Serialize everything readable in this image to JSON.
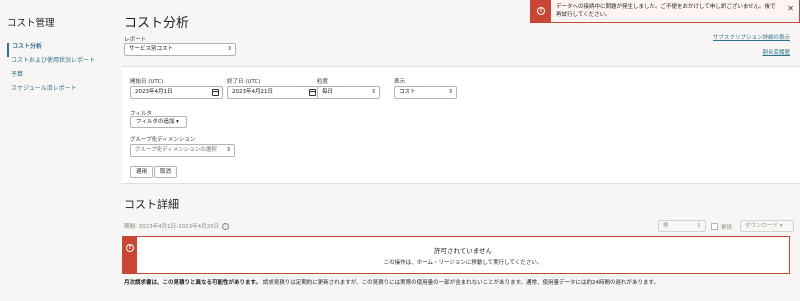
{
  "sidebar": {
    "title": "コスト管理",
    "items": [
      {
        "label": "コスト分析",
        "active": true
      },
      {
        "label": "コストおよび使用状況レポート",
        "active": false
      },
      {
        "label": "予算",
        "active": false
      },
      {
        "label": "スケジュール済レポート",
        "active": false
      }
    ]
  },
  "page": {
    "title": "コスト分析",
    "report_label": "レポート",
    "report_value": "サービス別コスト",
    "links": {
      "subscription": "サブスクリプション詳細の表示",
      "usage_history": "割合変履歴"
    }
  },
  "filters": {
    "start_date_label": "開始日 (UTC)",
    "start_date": "2023年4月1日",
    "end_date_label": "終了日 (UTC)",
    "end_date": "2023年4月21日",
    "granularity_label": "粒度",
    "granularity_value": "毎日",
    "show_label": "表示",
    "show_value": "コスト",
    "filter_label": "フィルタ",
    "add_filter": "フィルタの追加",
    "group_label": "グループ化ディメンション",
    "group_placeholder": "グループ化ディメンションの選択",
    "apply": "適用",
    "cancel": "取消"
  },
  "details": {
    "title": "コスト詳細",
    "period": "期間: 2023年4月1日-2023年4月25日",
    "granularity_select": "棒",
    "checkbox_label": "累積",
    "download": "ダウンロード"
  },
  "error": {
    "title": "許可されていません",
    "message": "この操作は、ホーム・リージョンに移動して実行してください。"
  },
  "note": {
    "bold": "月次請求書は、この見積りと異なる可能性があります。",
    "text": "請求見積りは定期的に更新されますが、この見積りには実際の使用量の一部が含まれないことがあります。通常、使用量データには約24時間の遅れがあります。"
  },
  "toast": {
    "message": "データへの接続中に問題が発生しました。ご不便をおかけして申し訳ございません。後で再試行してください。"
  },
  "colors": {
    "accent": "#31708f",
    "error": "#c74634",
    "background": "#f7f6f4"
  }
}
